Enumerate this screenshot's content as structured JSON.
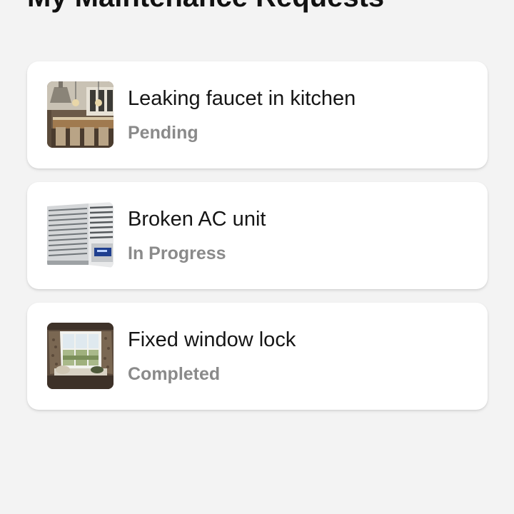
{
  "page": {
    "title": "My Maintenance Requests"
  },
  "requests": [
    {
      "title": "Leaking faucet in kitchen",
      "status": "Pending",
      "thumbnail_icon": "kitchen-photo"
    },
    {
      "title": "Broken AC unit",
      "status": "In Progress",
      "thumbnail_icon": "ac-unit-photo"
    },
    {
      "title": "Fixed window lock",
      "status": "Completed",
      "thumbnail_icon": "window-photo"
    }
  ],
  "colors": {
    "background": "#f3f3f3",
    "card": "#ffffff",
    "title_text": "#151515",
    "status_text": "#8a8a8a"
  }
}
